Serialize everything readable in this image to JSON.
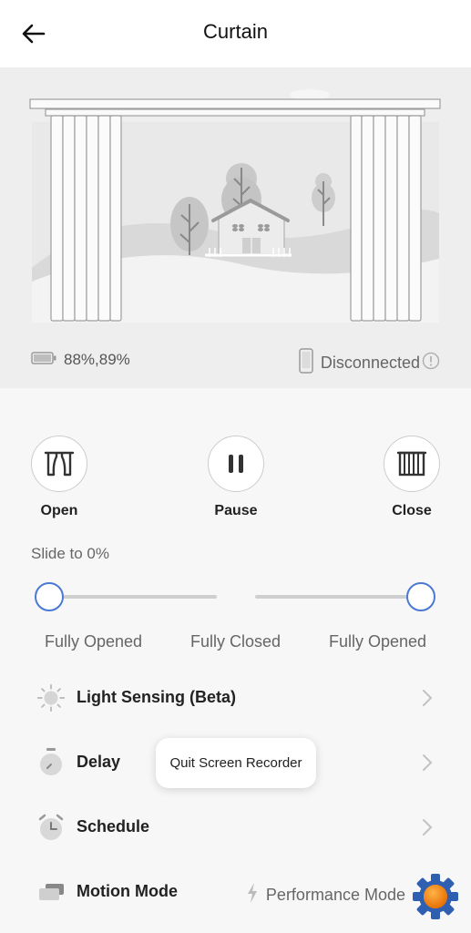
{
  "header": {
    "title": "Curtain"
  },
  "status": {
    "battery": "88%,89%",
    "connection": "Disconnected"
  },
  "controls": {
    "open": "Open",
    "pause": "Pause",
    "close": "Close"
  },
  "slider": {
    "title": "Slide to 0%",
    "left_start": "Fully Opened",
    "middle": "Fully Closed",
    "right_end": "Fully Opened",
    "left_position": 0,
    "right_position": 1
  },
  "settings": {
    "light_sensing": "Light Sensing (Beta)",
    "delay": "Delay",
    "schedule": "Schedule",
    "motion_mode": "Motion Mode",
    "motion_mode_value": "Performance Mode"
  },
  "toast": {
    "text": "Quit Screen Recorder"
  },
  "colors": {
    "accent": "#4a78d6",
    "background": "#f7f7f7",
    "scene": "#eeeeee"
  }
}
